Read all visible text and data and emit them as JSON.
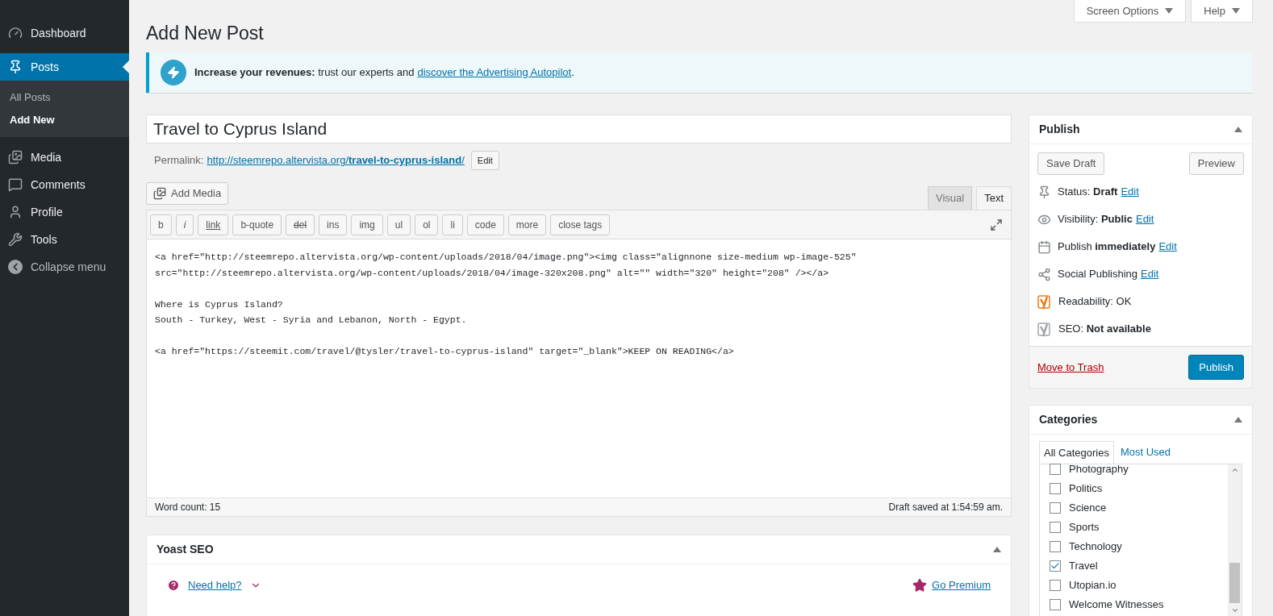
{
  "sidebar": {
    "items": [
      {
        "label": "Dashboard",
        "selected": false
      },
      {
        "label": "Posts",
        "selected": true,
        "expanded": true,
        "children": [
          {
            "label": "All Posts",
            "selected": false
          },
          {
            "label": "Add New",
            "selected": true
          }
        ]
      },
      {
        "label": "Media",
        "selected": false
      },
      {
        "label": "Comments",
        "selected": false
      },
      {
        "label": "Profile",
        "selected": false
      },
      {
        "label": "Tools",
        "selected": false
      },
      {
        "label": "Collapse menu",
        "selected": false
      }
    ]
  },
  "top_buttons": [
    "Screen Options",
    "Help"
  ],
  "page_title": "Add New Post",
  "notice": {
    "text": "**Increase your revenues:** trust our experts and",
    "link": "discover the Advertising Autopilot",
    "after": "."
  },
  "post_title": "Travel to Cyprus Island",
  "permalink": {
    "label": "Permalink:",
    "url_base": "http://steemrepo.altervista.org/",
    "slug": "travel-to-cyprus-island",
    "url_end": "/",
    "button": "Edit"
  },
  "add_media": "Add Media",
  "editor_tabs": [
    {
      "label": "Visual",
      "selected": false
    },
    {
      "label": "Text",
      "selected": true
    }
  ],
  "toolbar": [
    {
      "label": "b",
      "kind": "plain"
    },
    {
      "label": "i",
      "kind": "italic"
    },
    {
      "label": "link",
      "kind": "underline"
    },
    {
      "label": "b-quote",
      "kind": "plain"
    },
    {
      "label": "del",
      "kind": "strike"
    },
    {
      "label": "ins",
      "kind": "plain"
    },
    {
      "label": "img",
      "kind": "plain"
    },
    {
      "label": "ul",
      "kind": "plain"
    },
    {
      "label": "ol",
      "kind": "plain"
    },
    {
      "label": "li",
      "kind": "plain"
    },
    {
      "label": "code",
      "kind": "plain"
    },
    {
      "label": "more",
      "kind": "plain"
    },
    {
      "label": "close tags",
      "kind": "plain"
    }
  ],
  "content": [
    [
      "<a href=\"http://steemrepo.altervista.org/wp-content/uploads/2018/04/image.png\"><img class=\"alignnone size-medium wp-image-525\"",
      "src=\"http://steemrepo.altervista.org/wp-content/uploads/2018/04/image-320x208.png\" alt=\"\" width=\"320\" height=\"208\" /></a>"
    ],
    [
      "Where is Cyprus Island?",
      "South - Turkey, West - Syria and Lebanon, North - Egypt."
    ],
    [
      "<a href=\"https://steemit.com/travel/@tysler/travel-to-cyprus-island\" target=\"_blank\">KEEP ON READING</a>"
    ]
  ],
  "status_bar": {
    "word_count": "Word count: 15",
    "saved": "Draft saved at 1:54:59 am."
  },
  "yoast": {
    "title": "Yoast SEO",
    "help": "Need help?",
    "premium": "Go Premium"
  },
  "publish": {
    "title": "Publish",
    "save_draft": "Save Draft",
    "preview": "Preview",
    "rows": [
      {
        "text": "Status: **Draft**",
        "edit": "Edit"
      },
      {
        "text": "Visibility: **Public**",
        "edit": "Edit"
      },
      {
        "text": "Publish **immediately**",
        "edit": "Edit"
      },
      {
        "text": "Social Publishing",
        "edit": "Edit"
      },
      {
        "text": "Readability: OK"
      },
      {
        "text": "SEO: **Not available**"
      }
    ],
    "trash": "Move to Trash",
    "publish": "Publish"
  },
  "categories": {
    "title": "Categories",
    "tabs": [
      {
        "label": "All Categories",
        "selected": true
      },
      {
        "label": "Most Used",
        "selected": false
      }
    ],
    "items": [
      {
        "label": "Photography",
        "checked": false
      },
      {
        "label": "Politics",
        "checked": false
      },
      {
        "label": "Science",
        "checked": false
      },
      {
        "label": "Sports",
        "checked": false
      },
      {
        "label": "Technology",
        "checked": false
      },
      {
        "label": "Travel",
        "checked": true
      },
      {
        "label": "Utopian.io",
        "checked": false
      },
      {
        "label": "Welcome Witnesses",
        "checked": false
      }
    ]
  }
}
